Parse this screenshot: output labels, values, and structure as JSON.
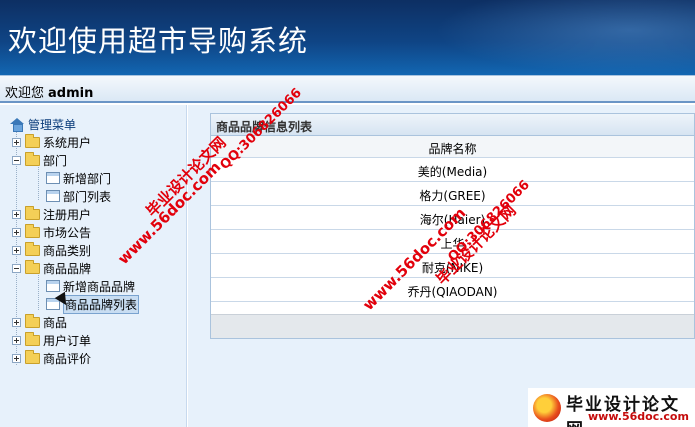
{
  "header": {
    "title": "欢迎使用超市导购系统"
  },
  "welcome": {
    "prefix": "欢迎您",
    "username": "admin"
  },
  "sidebar": {
    "root_label": "管理菜单",
    "items": [
      {
        "label": "系统用户",
        "expanded": false
      },
      {
        "label": "部门",
        "expanded": true,
        "children": [
          "新增部门",
          "部门列表"
        ]
      },
      {
        "label": "注册用户",
        "expanded": false
      },
      {
        "label": "市场公告",
        "expanded": false
      },
      {
        "label": "商品类别",
        "expanded": false
      },
      {
        "label": "商品品牌",
        "expanded": true,
        "children": [
          "新增商品品牌",
          "商品品牌列表"
        ],
        "selected_child": "商品品牌列表"
      },
      {
        "label": "商品",
        "expanded": false
      },
      {
        "label": "用户订单",
        "expanded": false
      },
      {
        "label": "商品评价",
        "expanded": false
      }
    ]
  },
  "panel": {
    "title": "商品品牌信息列表",
    "column_header": "品牌名称",
    "rows": [
      "美的(Media)",
      "格力(GREE)",
      "海尔(Haier)",
      "上华",
      "耐克(NIKE)",
      "乔丹(QIAODAN)"
    ]
  },
  "watermarks": {
    "w1": "毕业设计论文网",
    "w2": "QQ:306826066",
    "w3": "www.56doc.com",
    "w4": "www.56doc.com",
    "w5": "QQ:306826066",
    "w6": "毕业设计论文网"
  },
  "logo": {
    "name": "毕业设计论文网",
    "url": "www.56doc.com"
  },
  "colors": {
    "header": "#0f4484",
    "sidebar_bg": "#e7f1fb",
    "watermark": "#e2000b"
  }
}
